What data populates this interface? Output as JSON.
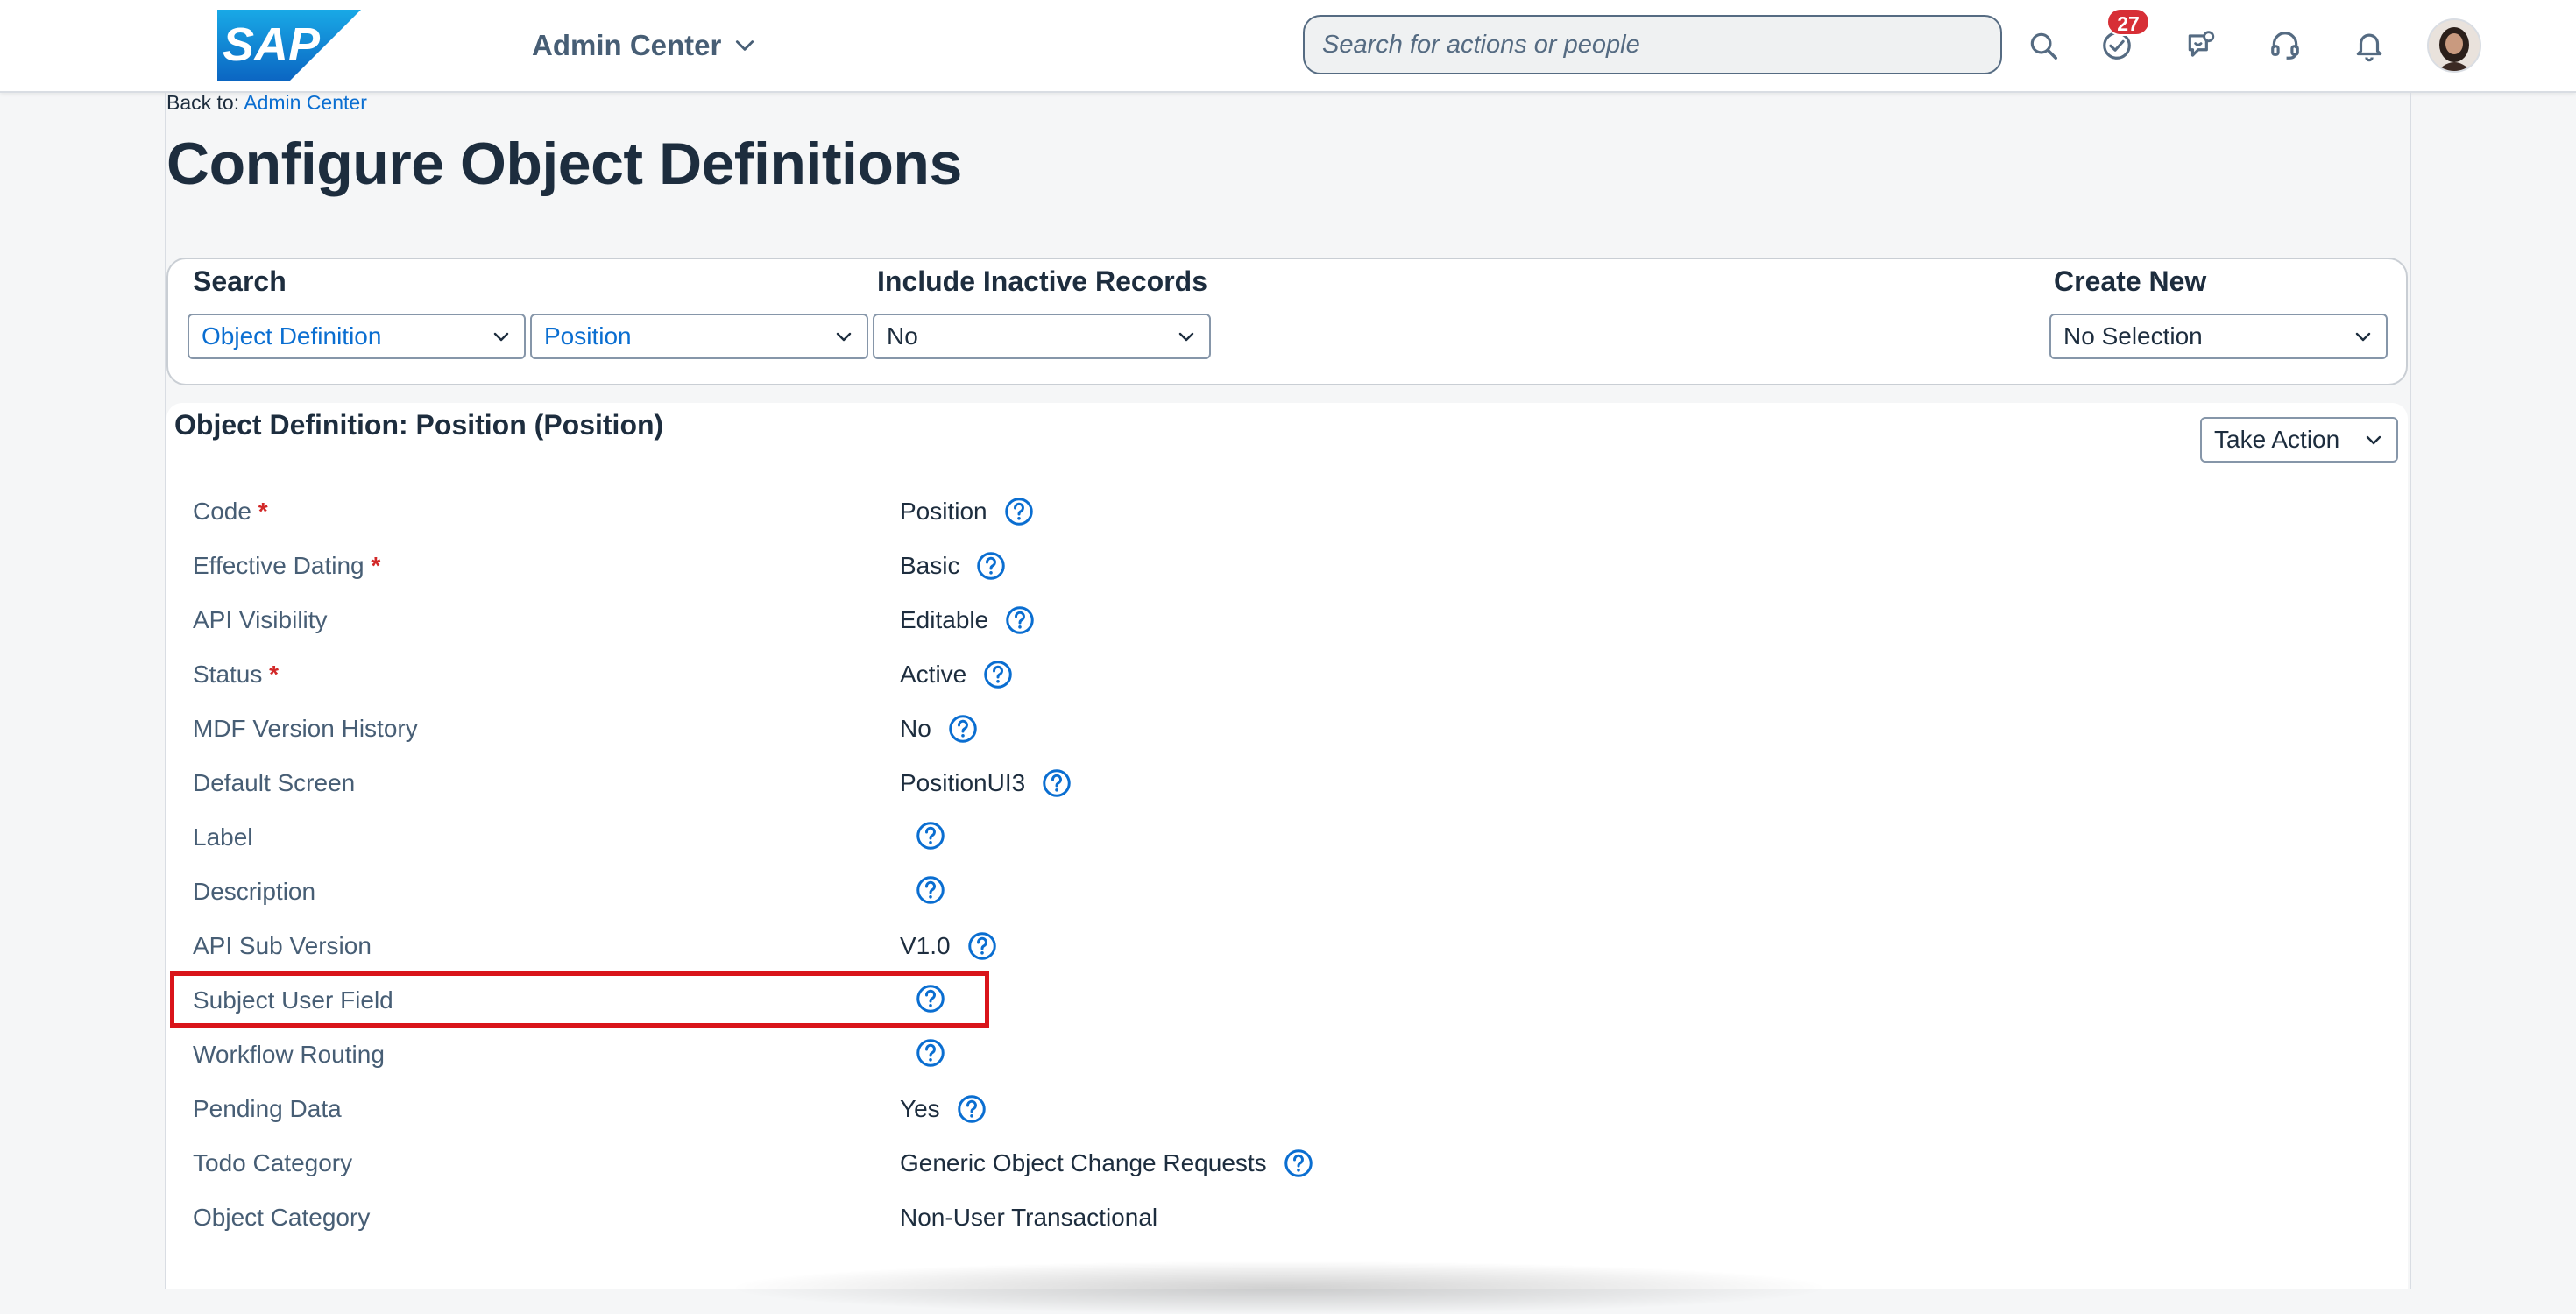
{
  "shell": {
    "logo_text": "SAP",
    "app_title": "Admin Center",
    "search_placeholder": "Search for actions or people",
    "todo_badge": "27",
    "icons": [
      "search-icon",
      "todo-check-icon",
      "chat-bot-icon",
      "headset-icon",
      "bell-icon",
      "avatar"
    ]
  },
  "breadcrumb": {
    "prefix": "Back to:",
    "link": "Admin Center"
  },
  "page_title": "Configure Object Definitions",
  "filters": {
    "search_label": "Search",
    "search_type": "Object Definition",
    "search_object": "Position",
    "inactive_label": "Include Inactive Records",
    "inactive_value": "No",
    "create_label": "Create New",
    "create_value": "No Selection"
  },
  "object": {
    "title": "Object Definition: Position (Position)",
    "take_action": "Take Action",
    "rows": [
      {
        "label": "Code",
        "required": "*",
        "value": "Position"
      },
      {
        "label": "Effective Dating",
        "required": "*",
        "value": "Basic"
      },
      {
        "label": "API Visibility",
        "value": "Editable"
      },
      {
        "label": "Status",
        "required": "*",
        "value": "Active"
      },
      {
        "label": "MDF Version History",
        "value": "No"
      },
      {
        "label": "Default Screen",
        "value": "PositionUI3"
      },
      {
        "label": "Label",
        "value": ""
      },
      {
        "label": "Description",
        "value": ""
      },
      {
        "label": "API Sub Version",
        "value": "V1.0"
      },
      {
        "label": "Subject User Field",
        "value": ""
      },
      {
        "label": "Workflow Routing",
        "value": ""
      },
      {
        "label": "Pending Data",
        "value": "Yes"
      },
      {
        "label": "Todo Category",
        "value": "Generic Object Change Requests"
      },
      {
        "label": "Object Category",
        "value": "Non-User Transactional"
      }
    ]
  },
  "colors": {
    "brand_blue": "#0a6ed1",
    "text_dark": "#1d2d3e",
    "label_gray": "#475e75",
    "required_red": "#d22828",
    "highlight_red": "#d9141a",
    "badge_red": "#d72f36"
  }
}
